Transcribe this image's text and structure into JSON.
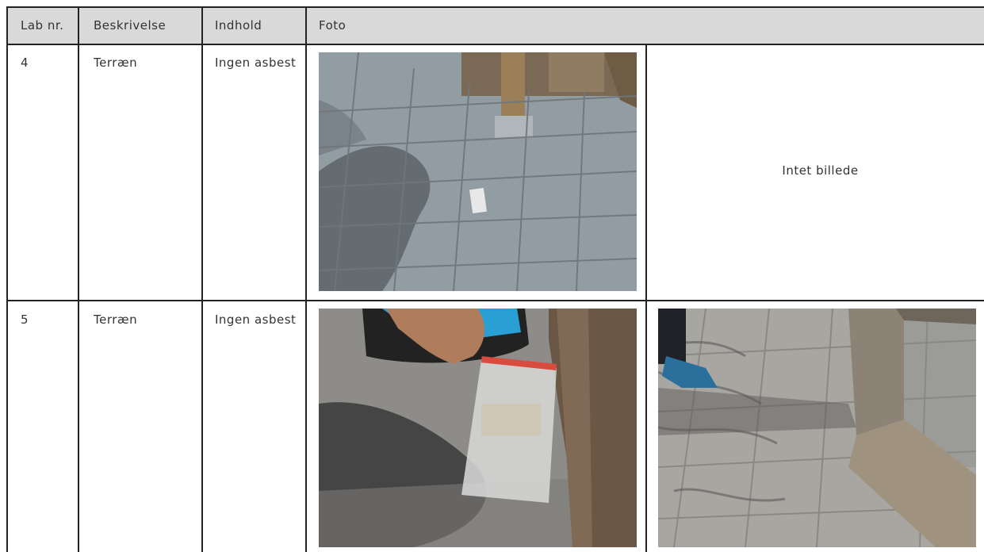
{
  "header": {
    "lab_nr": "Lab nr.",
    "beskrivelse": "Beskrivelse",
    "indhold": "Indhold",
    "foto": "Foto"
  },
  "rows": [
    {
      "lab_nr": "4",
      "beskrivelse": "Terræn",
      "indhold": "Ingen asbest",
      "photos": [
        "photo-tiles-with-sample-bag",
        "no-image"
      ],
      "no_image_text": "Intet billede"
    },
    {
      "lab_nr": "5",
      "beskrivelse": "Terræn",
      "indhold": "Ingen asbest",
      "photos": [
        "photo-hand-holding-sample-bag",
        "photo-tiles-and-wooden-beam"
      ]
    }
  ],
  "colors": {
    "header_bg": "#d9d9d9",
    "grid": "#222222"
  }
}
